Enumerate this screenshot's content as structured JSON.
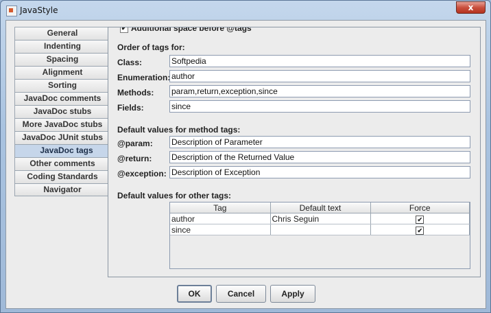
{
  "window": {
    "title": "JavaStyle",
    "close_label": "x"
  },
  "nav": {
    "items": [
      {
        "label": "General"
      },
      {
        "label": "Indenting"
      },
      {
        "label": "Spacing"
      },
      {
        "label": "Alignment"
      },
      {
        "label": "Sorting"
      },
      {
        "label": "JavaDoc comments"
      },
      {
        "label": "JavaDoc stubs"
      },
      {
        "label": "More JavaDoc stubs"
      },
      {
        "label": "JavaDoc JUnit stubs"
      },
      {
        "label": "JavaDoc tags",
        "selected": true
      },
      {
        "label": "Other comments"
      },
      {
        "label": "Coding Standards"
      },
      {
        "label": "Navigator"
      }
    ]
  },
  "panel": {
    "top_checkbox": {
      "label": "Additional space before @tags",
      "checked": true
    },
    "order": {
      "heading": "Order of tags for:",
      "class_label": "Class:",
      "class_value": "Softpedia",
      "enum_label": "Enumeration:",
      "enum_value": "author",
      "methods_label": "Methods:",
      "methods_value": "param,return,exception,since",
      "fields_label": "Fields:",
      "fields_value": "since"
    },
    "method_defaults": {
      "heading": "Default values for method tags:",
      "param_label": "@param:",
      "param_value": "Description of Parameter",
      "return_label": "@return:",
      "return_value": "Description of the Returned Value",
      "exception_label": "@exception:",
      "exception_value": "Description of Exception"
    },
    "other_defaults": {
      "heading": "Default values for other tags:",
      "columns": [
        "Tag",
        "Default text",
        "Force"
      ],
      "rows": [
        {
          "tag": "author",
          "text": "Chris Seguin",
          "force": "✔"
        },
        {
          "tag": "since",
          "text": "",
          "force": "✔"
        }
      ]
    }
  },
  "buttons": {
    "ok": "OK",
    "cancel": "Cancel",
    "apply": "Apply"
  }
}
